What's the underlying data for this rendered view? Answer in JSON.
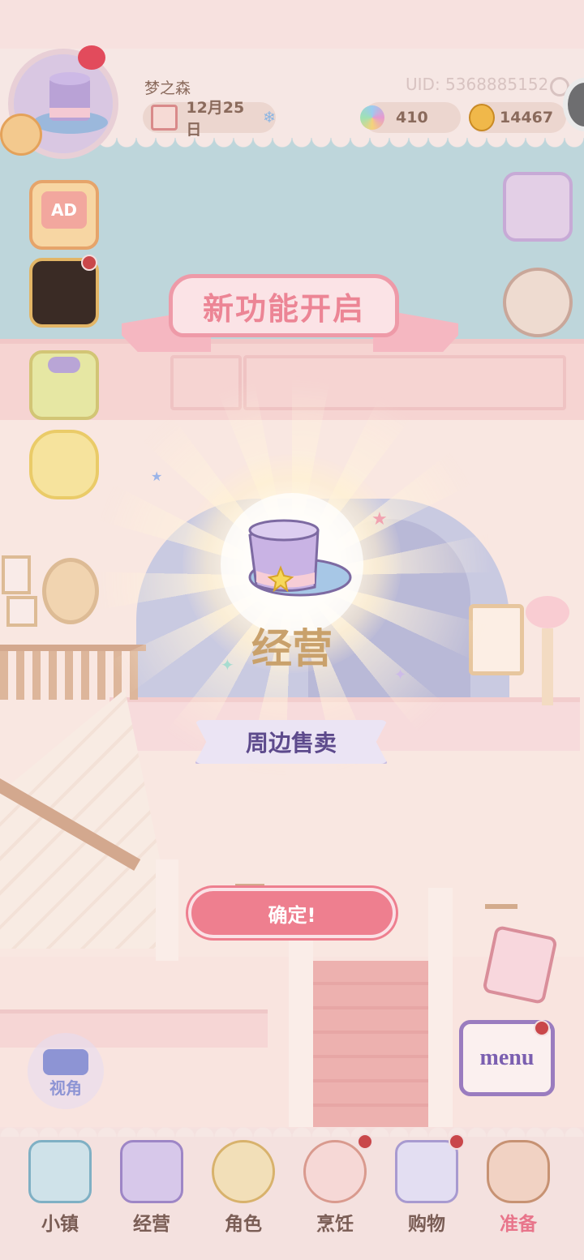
{
  "player": {
    "name": "梦之森",
    "uid": "UID: 5368885152",
    "date": "12月25日"
  },
  "currency": {
    "gems": "410",
    "coins": "14467"
  },
  "side_left": {
    "ad_label": "AD"
  },
  "popup": {
    "banner_title": "新功能开启",
    "feature_name": "经营",
    "feature_desc": "周边售卖",
    "confirm_label": "确定!"
  },
  "view_button": {
    "label": "视角"
  },
  "menu_button": {
    "label": "menu"
  },
  "bottom_nav": {
    "items": [
      {
        "label": "小镇",
        "icon": "town-map-icon"
      },
      {
        "label": "经营",
        "icon": "top-hat-icon"
      },
      {
        "label": "角色",
        "icon": "character-icon"
      },
      {
        "label": "烹饪",
        "icon": "cooking-icon"
      },
      {
        "label": "购物",
        "icon": "shopping-bag-icon"
      },
      {
        "label": "准备",
        "icon": "prepare-basket-icon"
      }
    ],
    "active_index": 5
  },
  "colors": {
    "accent_pink": "#ee7f8f",
    "purple_label": "#5d4a8c",
    "gold_text": "#c9a16b"
  }
}
